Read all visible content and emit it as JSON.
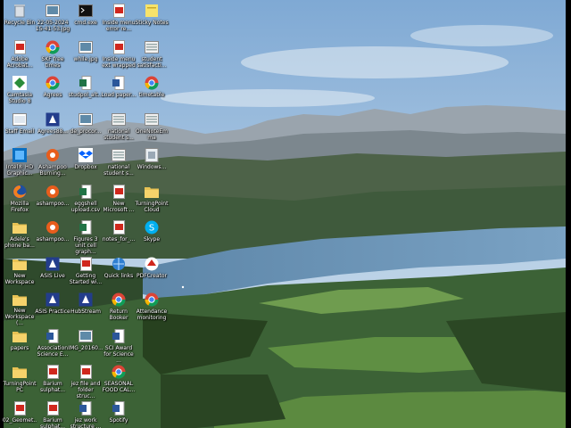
{
  "desktop": {
    "icons": [
      {
        "label": "Recycle Bin",
        "icon": "recycle-bin-icon"
      },
      {
        "label": "Adobe Acrobat...",
        "icon": "pdf-icon"
      },
      {
        "label": "Camtasia Studio 8",
        "icon": "camtasia-icon"
      },
      {
        "label": "Staff Email",
        "icon": "email-shortcut-icon"
      },
      {
        "label": "Intel® HD Graphic...",
        "icon": "intel-graphics-icon"
      },
      {
        "label": "Mozilla Firefox",
        "icon": "firefox-icon"
      },
      {
        "label": "Adele's phone ba...",
        "icon": "folder-icon"
      },
      {
        "label": "New Workspace",
        "icon": "folder-icon"
      },
      {
        "label": "New Workspace (...",
        "icon": "folder-icon"
      },
      {
        "label": "papers",
        "icon": "folder-icon"
      },
      {
        "label": "TurningPoint PC",
        "icon": "folder-icon"
      },
      {
        "label": "02_Geomet... (RecLattice...",
        "icon": "pdf-icon"
      },
      {
        "label": "22-05-2024 15-41-53.jpg",
        "icon": "image-file-icon"
      },
      {
        "label": "SKF free times",
        "icon": "chrome-icon"
      },
      {
        "label": "Agrees",
        "icon": "chrome-icon"
      },
      {
        "label": "Agrees88...",
        "icon": "app-blue-icon"
      },
      {
        "label": "Ashampoo Burning...",
        "icon": "ashampoo-icon"
      },
      {
        "label": "ashampoo...",
        "icon": "ashampoo-icon"
      },
      {
        "label": "ashampoo...",
        "icon": "ashampoo-icon"
      },
      {
        "label": "ASIS Live",
        "icon": "app-blue-icon"
      },
      {
        "label": "ASIS Practice",
        "icon": "app-blue-icon"
      },
      {
        "label": "Association Science E...",
        "icon": "word-doc-icon"
      },
      {
        "label": "Barium sulphat...",
        "icon": "pdf-icon"
      },
      {
        "label": "Barium sulphat...",
        "icon": "pdf-icon"
      },
      {
        "label": "cmd.exe",
        "icon": "cmd-icon"
      },
      {
        "label": "while.jpg",
        "icon": "image-file-icon"
      },
      {
        "label": "studpol_alt...",
        "icon": "excel-icon"
      },
      {
        "label": "de_procor...",
        "icon": "image-file-icon"
      },
      {
        "label": "Dropbox",
        "icon": "dropbox-icon"
      },
      {
        "label": "eggshell upload.csv",
        "icon": "excel-icon"
      },
      {
        "label": "Figures 3 unit cell graph...",
        "icon": "excel-icon"
      },
      {
        "label": "Getting Started wi...",
        "icon": "pdf-icon"
      },
      {
        "label": "HubStream",
        "icon": "app-blue-icon"
      },
      {
        "label": "IMG_20160...",
        "icon": "image-file-icon"
      },
      {
        "label": "jez file and folder struc...",
        "icon": "pdf-icon"
      },
      {
        "label": "jez work structure ...",
        "icon": "word-doc-icon"
      },
      {
        "label": "Inside menu error re...",
        "icon": "pdf-icon"
      },
      {
        "label": "Inside menu ext wrapped",
        "icon": "pdf-icon"
      },
      {
        "label": "Load paper...",
        "icon": "word-doc-icon"
      },
      {
        "label": "national student s...",
        "icon": "generic-file-icon"
      },
      {
        "label": "national student s...",
        "icon": "generic-file-icon"
      },
      {
        "label": "New Microsoft ...",
        "icon": "pdf-icon"
      },
      {
        "label": "notes_for_...",
        "icon": "pdf-icon"
      },
      {
        "label": "Quick links",
        "icon": "network-icon"
      },
      {
        "label": "Return Booker",
        "icon": "chrome-icon"
      },
      {
        "label": "SCI Award for Science ...",
        "icon": "word-doc-icon"
      },
      {
        "label": "SEASONAL FOOD CAL...",
        "icon": "chrome-icon"
      },
      {
        "label": "Spotify",
        "icon": "word-doc-icon"
      },
      {
        "label": "Sticky Notes",
        "icon": "sticky-notes-icon"
      },
      {
        "label": "student satisfacti...",
        "icon": "generic-file-icon"
      },
      {
        "label": "timetable",
        "icon": "chrome-icon"
      },
      {
        "label": "OneNoteEmma",
        "icon": "generic-file-icon"
      },
      {
        "label": "Windows...",
        "icon": "windows-file-icon"
      },
      {
        "label": "TurningPoint Cloud",
        "icon": "folder-icon"
      },
      {
        "label": "Skype",
        "icon": "skype-icon"
      },
      {
        "label": "PDFCreator",
        "icon": "pdfcreator-icon"
      },
      {
        "label": "Attendance monitoring",
        "icon": "chrome-icon"
      }
    ]
  }
}
